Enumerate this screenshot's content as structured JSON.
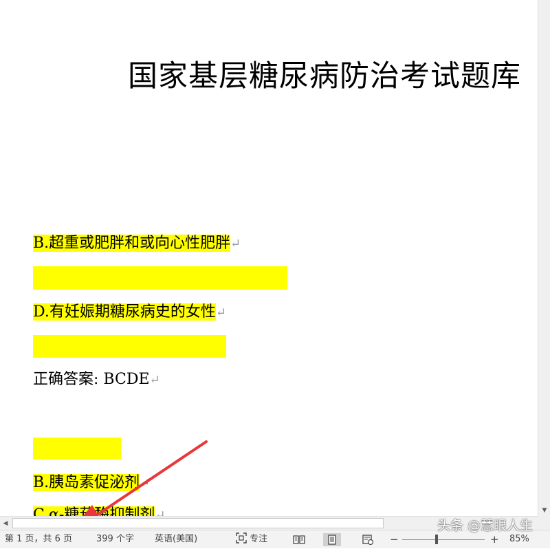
{
  "document": {
    "title": "国家基层糖尿病防治考试题库",
    "lines": [
      {
        "text": "B.超重或肥胖和或向心性肥胖"
      },
      {
        "text": "D.有妊娠期糖尿病史的女性"
      },
      {
        "text": "正确答案: BCDE"
      },
      {
        "text": "B.胰岛素促泌剂"
      },
      {
        "text": "C.α-糖苷酶抑制剂"
      }
    ],
    "paragraph_mark": "↵"
  },
  "status_bar": {
    "page_info": "第 1 页，共 6 页",
    "word_count": "399 个字",
    "language": "英语(美国)",
    "focus_label": "专注",
    "zoom_minus": "−",
    "zoom_plus": "+",
    "zoom_level": "85%",
    "zoom_fraction": 0.85
  },
  "scrollbars": {
    "left_arrow": "◀",
    "down_arrow": "▼"
  },
  "watermark": "头条 @慧眼人生",
  "colors": {
    "highlight": "#ffff00",
    "annotation_arrow": "#e8373a"
  },
  "icons": [
    "focus-icon",
    "read-mode-icon",
    "print-layout-icon",
    "web-layout-icon",
    "left-arrow-icon",
    "down-arrow-icon"
  ]
}
